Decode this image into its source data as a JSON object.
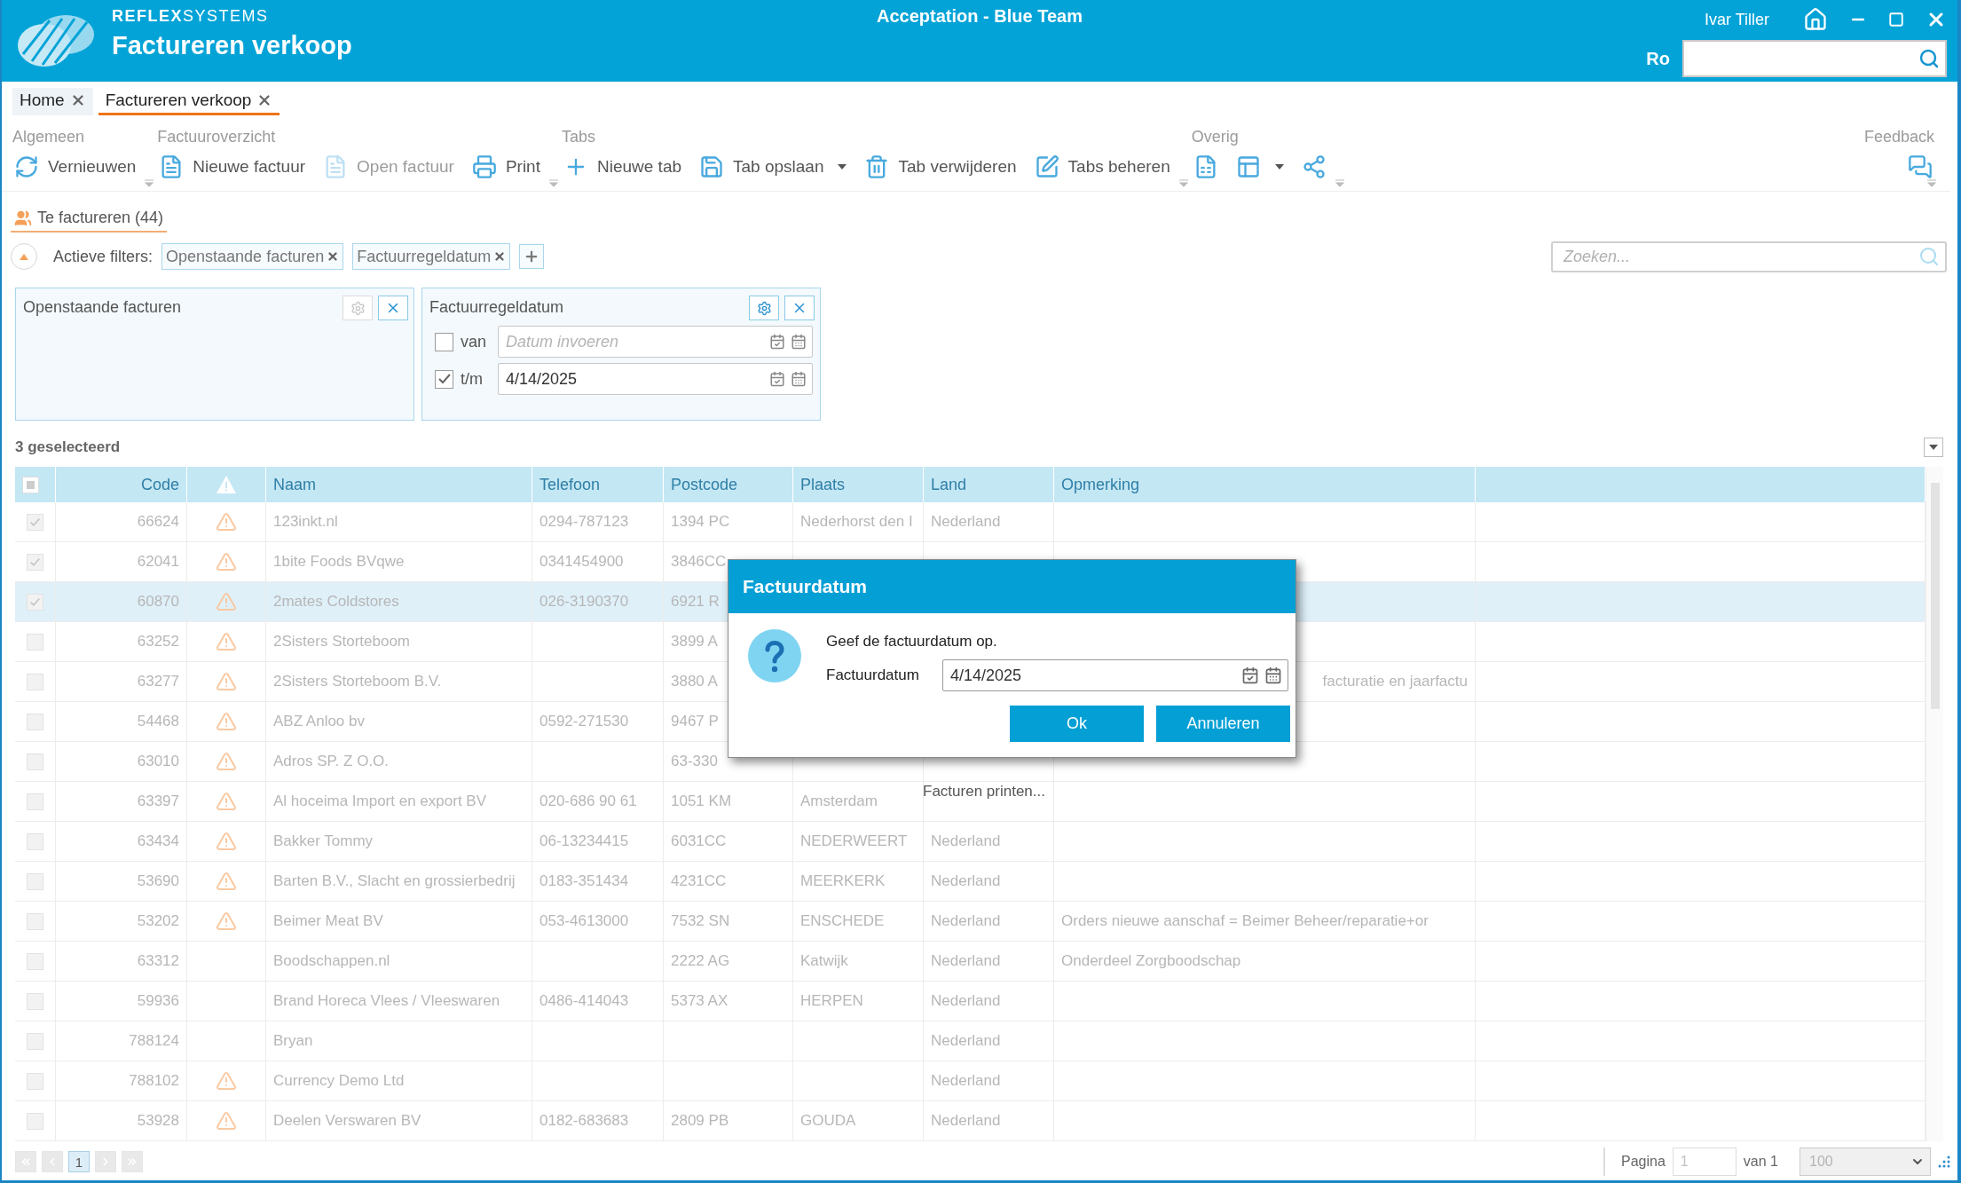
{
  "header": {
    "brand": "**REFLEX**SYSTEMS",
    "title": "Factureren verkoop",
    "environment": "Acceptation - Blue Team",
    "user": "Ivar Tiller",
    "company": "Ro"
  },
  "doc_tabs": [
    {
      "label": "Home",
      "selected": false
    },
    {
      "label": "Factureren verkoop",
      "selected": true
    }
  ],
  "ribbon": [
    {
      "label": "Algemeen",
      "items": [
        {
          "label": "Vernieuwen",
          "disabled": false,
          "has_menu": false
        }
      ]
    },
    {
      "label": "Factuuroverzicht",
      "items": [
        {
          "label": "Nieuwe factuur",
          "disabled": false,
          "has_menu": false
        },
        {
          "label": "Open factuur",
          "disabled": true,
          "has_menu": false
        },
        {
          "label": "Print",
          "disabled": false,
          "has_menu": false
        }
      ]
    },
    {
      "label": "Tabs",
      "items": [
        {
          "label": "Nieuwe tab",
          "disabled": false,
          "has_menu": false
        },
        {
          "label": "Tab opslaan",
          "disabled": false,
          "has_menu": true
        },
        {
          "label": "Tab verwijderen",
          "disabled": false,
          "has_menu": false
        },
        {
          "label": "Tabs beheren",
          "disabled": false,
          "has_menu": false
        }
      ]
    },
    {
      "label": "Overig",
      "items": [
        {
          "disabled": false,
          "has_menu": false
        },
        {
          "disabled": false,
          "has_menu": true
        },
        {
          "disabled": false,
          "has_menu": false
        }
      ]
    },
    {
      "label": "Feedback",
      "items": [
        {
          "disabled": false,
          "has_menu": false
        }
      ]
    }
  ],
  "view_tabs": [
    {
      "label": "Te factureren (44)",
      "selected": true
    }
  ],
  "filters": {
    "label": "Actieve filters:",
    "chips": [
      "Openstaande facturen",
      "Factuurregeldatum"
    ],
    "search_placeholder": "Zoeken..."
  },
  "filter_panels": [
    {
      "title": "Openstaande facturen",
      "settings_enabled": false
    },
    {
      "title": "Factuurregeldatum",
      "settings_enabled": true,
      "fields": [
        {
          "label": "van",
          "checked": false,
          "placeholder": "Datum invoeren"
        },
        {
          "label": "t/m",
          "checked": true,
          "value": "4/14/2025"
        }
      ]
    }
  ],
  "selection_summary": "3 geselecteerd",
  "table": {
    "select_all_indeterminate": true,
    "columns": [
      {
        "kind": "text",
        "label": "Code"
      },
      {
        "kind": "icon"
      },
      {
        "kind": "text",
        "label": "Naam"
      },
      {
        "kind": "text",
        "label": "Telefoon"
      },
      {
        "kind": "text",
        "label": "Postcode"
      },
      {
        "kind": "text",
        "label": "Plaats"
      },
      {
        "kind": "text",
        "label": "Land"
      },
      {
        "kind": "text",
        "label": "Opmerking"
      }
    ],
    "rows": [
      {
        "checked": true,
        "selected": false,
        "warning": true,
        "code": "66624",
        "name": "123inkt.nl",
        "phone": "0294-787123",
        "postcode": "1394 PC",
        "city": "Nederhorst den I",
        "country": "Nederland"
      },
      {
        "checked": true,
        "selected": false,
        "warning": true,
        "code": "62041",
        "name": "1bite Foods BVqwe",
        "phone": "0341454900",
        "postcode": "3846CC"
      },
      {
        "checked": true,
        "selected": true,
        "warning": true,
        "code": "60870",
        "name": "2mates Coldstores",
        "phone": "026-3190370",
        "postcode": "6921 R"
      },
      {
        "checked": false,
        "selected": false,
        "warning": true,
        "code": "63252",
        "name": "2Sisters Storteboom",
        "postcode": "3899 A"
      },
      {
        "checked": false,
        "selected": false,
        "warning": true,
        "code": "63277",
        "name": "2Sisters Storteboom B.V.",
        "postcode": "3880 A",
        "remark_tail": "facturatie en jaarfactu"
      },
      {
        "checked": false,
        "selected": false,
        "warning": true,
        "code": "54468",
        "name": "ABZ Anloo bv",
        "phone": "0592-271530",
        "postcode": "9467 P"
      },
      {
        "checked": false,
        "selected": false,
        "warning": true,
        "code": "63010",
        "name": "Adros SP. Z O.O.",
        "postcode": "63-330"
      },
      {
        "checked": false,
        "selected": false,
        "warning": true,
        "code": "63397",
        "name": "Al hoceima Import en export BV",
        "phone": "020-686 90 61",
        "postcode": "1051 KM",
        "city": "Amsterdam"
      },
      {
        "checked": false,
        "selected": false,
        "warning": true,
        "code": "63434",
        "name": "Bakker Tommy",
        "phone": "06-13234415",
        "postcode": "6031CC",
        "city": "NEDERWEERT",
        "country": "Nederland"
      },
      {
        "checked": false,
        "selected": false,
        "warning": true,
        "code": "53690",
        "name": "Barten B.V., Slacht en grossierbedrij",
        "phone": "0183-351434",
        "postcode": "4231CC",
        "city": "MEERKERK",
        "country": "Nederland"
      },
      {
        "checked": false,
        "selected": false,
        "warning": true,
        "code": "53202",
        "name": "Beimer Meat BV",
        "phone": "053-4613000",
        "postcode": "7532 SN",
        "city": "ENSCHEDE",
        "country": "Nederland",
        "remark": "Orders nieuwe aanschaf = Beimer Beheer/reparatie+or"
      },
      {
        "checked": false,
        "selected": false,
        "warning": false,
        "code": "63312",
        "name": "Boodschappen.nl",
        "postcode": "2222 AG",
        "city": "Katwijk",
        "country": "Nederland",
        "remark": "Onderdeel Zorgboodschap"
      },
      {
        "checked": false,
        "selected": false,
        "warning": false,
        "code": "59936",
        "name": "Brand Horeca Vlees / Vleeswaren",
        "phone": "0486-414043",
        "postcode": "5373 AX",
        "city": "HERPEN",
        "country": "Nederland"
      },
      {
        "checked": false,
        "selected": false,
        "warning": false,
        "code": "788124",
        "name": "Bryan",
        "country": "Nederland"
      },
      {
        "checked": false,
        "selected": false,
        "warning": true,
        "code": "788102",
        "name": "Currency Demo Ltd",
        "country": "Nederland"
      },
      {
        "checked": false,
        "selected": false,
        "warning": true,
        "code": "53928",
        "name": "Deelen Verswaren BV",
        "phone": "0182-683683",
        "postcode": "2809 PB",
        "city": "GOUDA",
        "country": "Nederland"
      }
    ]
  },
  "status_text": "Facturen printen...",
  "pager": {
    "pages": [
      {
        "label": "1",
        "selected": true
      }
    ],
    "page_label": "Pagina",
    "page_value": "1",
    "of_label": "van 1",
    "page_size": "100"
  },
  "dialog": {
    "title": "Factuurdatum",
    "message": "Geef de factuurdatum op.",
    "field_label": "Factuurdatum",
    "field_value": "4/14/2025",
    "buttons": [
      "Ok",
      "Annuleren"
    ]
  }
}
